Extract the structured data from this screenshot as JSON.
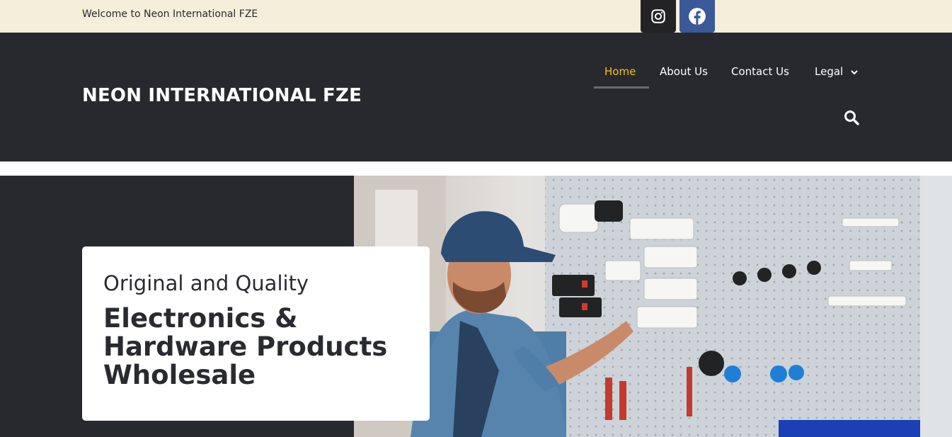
{
  "topbar": {
    "welcome": "Welcome to Neon International FZE",
    "social": [
      {
        "name": "instagram-icon",
        "bg": "#232326"
      },
      {
        "name": "facebook-icon",
        "bg": "#3b5998"
      }
    ]
  },
  "header": {
    "brand": "NEON INTERNATIONAL FZE",
    "nav": {
      "home": "Home",
      "about": "About Us",
      "contact": "Contact Us",
      "legal": "Legal"
    },
    "active_color": "#f2c21b",
    "search_icon": "search-icon"
  },
  "hero": {
    "subtitle": "Original and Quality",
    "title_lines": [
      "Electronics &",
      "Hardware Products",
      "Wholesale"
    ]
  },
  "colors": {
    "topbar": "#f5eedb",
    "header": "#28292e",
    "text_dark": "#2a2b30"
  }
}
